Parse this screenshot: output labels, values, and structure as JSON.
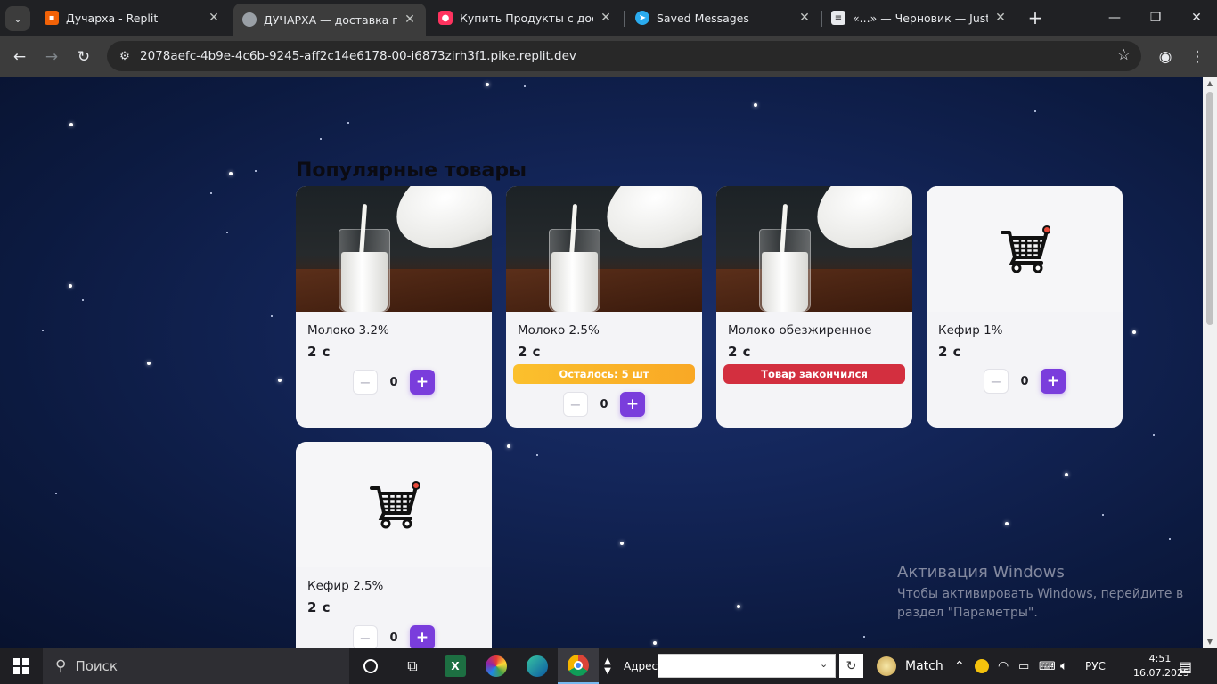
{
  "browser": {
    "tabs": [
      {
        "title": "Дучарха - Replit",
        "icon": "replit-icon",
        "color": "#f26207"
      },
      {
        "title": "ДУЧАРХА — доставка продукт",
        "icon": "globe-icon",
        "color": "#9aa0a6"
      },
      {
        "title": "Купить Продукты с доставкой",
        "icon": "samokat-icon",
        "color": "#ff335f"
      },
      {
        "title": "Saved Messages",
        "icon": "telegram-icon",
        "color": "#2aabee"
      },
      {
        "title": "«...» — Черновик — JustNotes",
        "icon": "document-icon",
        "color": "#e8eaed"
      }
    ],
    "url": "2078aefc-4b9e-4c6b-9245-aff2c14e6178-00-i6873zirh3f1.pike.replit.dev"
  },
  "page": {
    "section_title": "Популярные товары",
    "products": [
      {
        "name": "Молоко 3.2%",
        "price": "2 с",
        "image": "milk-photo",
        "stock_label": "",
        "quantity": "0"
      },
      {
        "name": "Молоко 2.5%",
        "price": "2 с",
        "image": "milk-photo",
        "stock_label": "Осталось: 5 шт",
        "quantity": "0"
      },
      {
        "name": "Молоко обезжиренное",
        "price": "2 с",
        "image": "milk-photo",
        "stock_label": "Товар закончился",
        "quantity": ""
      },
      {
        "name": "Кефир 1%",
        "price": "2 с",
        "image": "cart-icon",
        "stock_label": "",
        "quantity": "0"
      },
      {
        "name": "Кефир 2.5%",
        "price": "2 с",
        "image": "cart-icon",
        "stock_label": "",
        "quantity": "0"
      }
    ],
    "button_minus": "−",
    "button_plus": "+",
    "accent_color": "#7a3ddc",
    "low_stock_color": "#fbc02d",
    "out_of_stock_color": "#d32f3f"
  },
  "watermark": {
    "title": "Активация Windows",
    "line1": "Чтобы активировать Windows, перейдите в",
    "line2": "раздел \"Параметры\"."
  },
  "taskbar": {
    "search_placeholder": "Поиск",
    "address_label": "Адрес",
    "weather_label": "Match",
    "language": "РУС",
    "time": "4:51",
    "date": "16.07.2025"
  }
}
